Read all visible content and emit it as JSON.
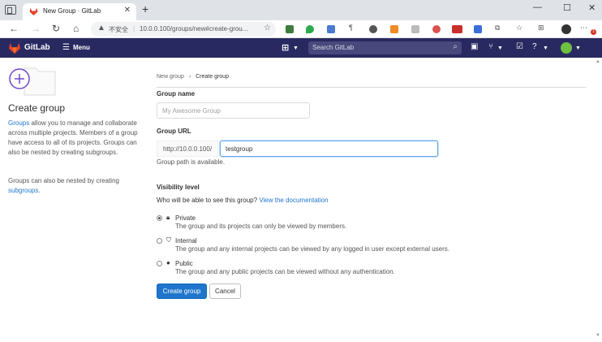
{
  "browser": {
    "tab_title": "New Group · GitLab",
    "tab_close": "✕",
    "new_tab": "+",
    "window_controls": [
      "—",
      "☐",
      "✕"
    ],
    "security_label": "不安全",
    "url": "10.0.0.100/groups/new#create-grou...",
    "notification_badge": "1"
  },
  "gitlab": {
    "brand": "GitLab",
    "menu_label": "Menu",
    "search_placeholder": "Search GitLab",
    "colors": {
      "header": "#292961",
      "primary": "#1f75cb",
      "link": "#1f75cb"
    }
  },
  "sidebar": {
    "heading": "Create group",
    "para1_link": "Groups",
    "para1_text": " allow you to manage and collaborate across multiple projects. Members of a group have access to all of its projects. Groups can also be nested by creating subgroups.",
    "para2_text": "Groups can also be nested by creating ",
    "para2_link": "subgroups",
    "para2_end": "."
  },
  "breadcrumb": {
    "parent": "New group",
    "separator": "›",
    "current": "Create group"
  },
  "form": {
    "group_name_label": "Group name",
    "group_name_placeholder": "My Awesome Group",
    "group_url_label": "Group URL",
    "group_url_prefix": "http://10.0.0.100/",
    "group_url_value": "testgroup",
    "group_path_help": "Group path is available.",
    "visibility_label": "Visibility level",
    "visibility_question": "Who will be able to see this group?",
    "visibility_doc_link": "View the documentation",
    "visibility_options": [
      {
        "title": "Private",
        "description": "The group and its projects can only be viewed by members.",
        "checked": true,
        "icon": "lock-icon"
      },
      {
        "title": "Internal",
        "description": "The group and any internal projects can be viewed by any logged in user except external users.",
        "checked": false,
        "icon": "shield-icon"
      },
      {
        "title": "Public",
        "description": "The group and any public projects can be viewed without any authentication.",
        "checked": false,
        "icon": "globe-icon"
      }
    ],
    "create_button": "Create group",
    "cancel_button": "Cancel"
  }
}
